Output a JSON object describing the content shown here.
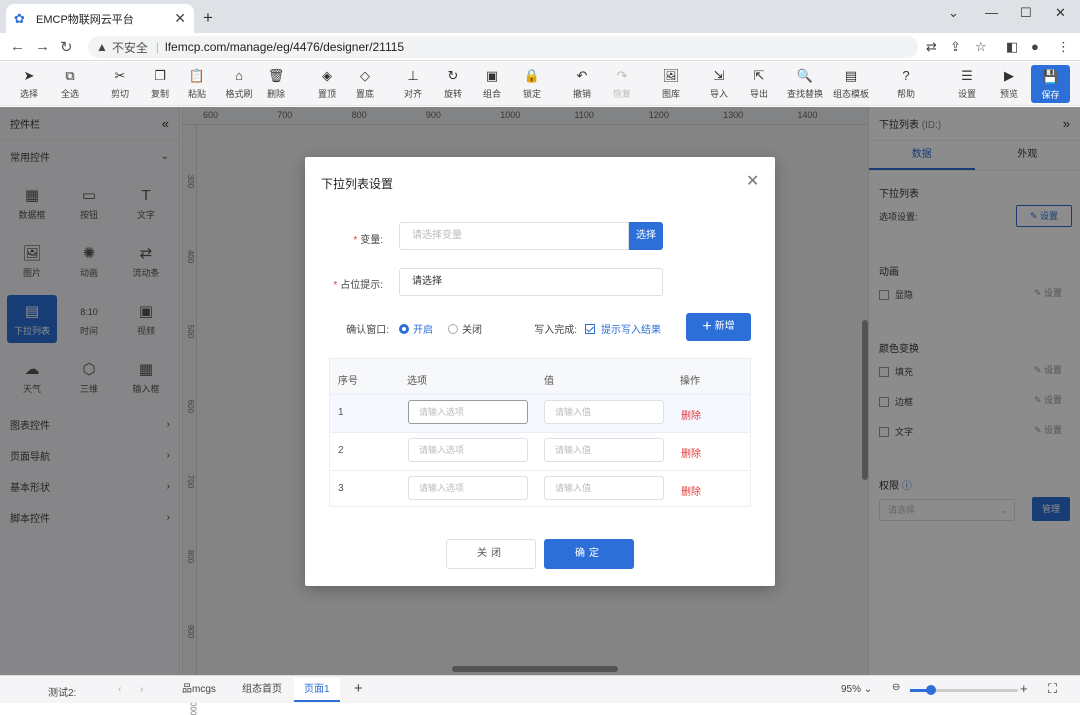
{
  "browser": {
    "tab_title": "EMCP物联网云平台",
    "insecure": "不安全",
    "url": "lfemcp.com/manage/eg/4476/designer/21115"
  },
  "toolbar": [
    {
      "id": "select",
      "label": "选择",
      "glyph": "➤"
    },
    {
      "id": "select-all",
      "label": "全选",
      "glyph": "⧉"
    },
    {
      "id": "cut",
      "label": "剪切",
      "glyph": "✂"
    },
    {
      "id": "copy",
      "label": "复制",
      "glyph": "❐"
    },
    {
      "id": "paste",
      "label": "粘贴",
      "glyph": "📋"
    },
    {
      "id": "format-brush",
      "label": "格式刷",
      "glyph": "⌂"
    },
    {
      "id": "delete",
      "label": "删除",
      "glyph": "🗑"
    },
    {
      "id": "bring-top",
      "label": "置顶",
      "glyph": "◈"
    },
    {
      "id": "send-bottom",
      "label": "置底",
      "glyph": "◇"
    },
    {
      "id": "align",
      "label": "对齐",
      "glyph": "⊥"
    },
    {
      "id": "rotate",
      "label": "旋转",
      "glyph": "↻"
    },
    {
      "id": "group",
      "label": "组合",
      "glyph": "▣"
    },
    {
      "id": "lock",
      "label": "锁定",
      "glyph": "🔒"
    },
    {
      "id": "undo",
      "label": "撤销",
      "glyph": "↶"
    },
    {
      "id": "redo",
      "label": "恢复",
      "glyph": "↷"
    },
    {
      "id": "gallery",
      "label": "图库",
      "glyph": "🖼"
    },
    {
      "id": "import",
      "label": "导入",
      "glyph": "⇲"
    },
    {
      "id": "export",
      "label": "导出",
      "glyph": "⇱"
    },
    {
      "id": "find-replace",
      "label": "查找替换",
      "glyph": "🔍"
    },
    {
      "id": "template",
      "label": "组态模板",
      "glyph": "▤"
    },
    {
      "id": "help",
      "label": "帮助",
      "glyph": "?"
    },
    {
      "id": "settings",
      "label": "设置",
      "glyph": "☰"
    },
    {
      "id": "preview",
      "label": "预览",
      "glyph": "▶"
    }
  ],
  "save_label": "保存",
  "left_panel": {
    "title": "控件栏",
    "section_common": "常用控件",
    "widgets": [
      {
        "id": "data-box",
        "label": "数据框",
        "glyph": "▦"
      },
      {
        "id": "button",
        "label": "按钮",
        "glyph": "▭"
      },
      {
        "id": "text",
        "label": "文字",
        "glyph": "T"
      },
      {
        "id": "image",
        "label": "图片",
        "glyph": "🖼"
      },
      {
        "id": "animation",
        "label": "动画",
        "glyph": "✺"
      },
      {
        "id": "flow-bar",
        "label": "流动条",
        "glyph": "⇄"
      },
      {
        "id": "dropdown-list",
        "label": "下拉列表",
        "glyph": "▤"
      },
      {
        "id": "time",
        "label": "时间",
        "glyph": "8:10"
      },
      {
        "id": "video",
        "label": "视频",
        "glyph": "▣"
      },
      {
        "id": "weather",
        "label": "天气",
        "glyph": "☁"
      },
      {
        "id": "3d",
        "label": "三维",
        "glyph": "⬡"
      },
      {
        "id": "input-box",
        "label": "输入框",
        "glyph": "▦"
      }
    ],
    "categories": [
      "图表控件",
      "页面导航",
      "基本形状",
      "脚本控件"
    ]
  },
  "rulers": {
    "h": [
      "600",
      "700",
      "800",
      "900",
      "1000",
      "1100",
      "1200",
      "1300",
      "1400"
    ],
    "v": [
      "300",
      "400",
      "500",
      "600",
      "700",
      "800",
      "900",
      "1000"
    ]
  },
  "right_panel": {
    "title": "下拉列表",
    "id_label": "(ID:)",
    "tab_data": "数据",
    "tab_look": "外观",
    "sec_dropdown": "下拉列表",
    "options_label": "选项设置:",
    "set_button": "设置",
    "sec_anim": "动画",
    "hide": "显隐",
    "sec_color": "颜色变换",
    "fill": "填充",
    "border": "边框",
    "text": "文字",
    "sec_perm": "权限",
    "perm_placeholder": "请选择",
    "manage_button": "管理"
  },
  "status": {
    "test": "测试2:",
    "page_mcgs": "品mcgs",
    "page_home": "组态首页",
    "page_1": "页面1",
    "zoom": "95%"
  },
  "dialog": {
    "title": "下拉列表设置",
    "variable_label": "变量:",
    "variable_placeholder": "请选择变量",
    "select_button": "选择",
    "placeholder_label": "占位提示:",
    "placeholder_value": "请选择",
    "confirm_label": "确认窗口:",
    "confirm_on": "开启",
    "confirm_off": "关闭",
    "write_done_label": "写入完成:",
    "write_done_option": "提示写入结果",
    "add_button": "新增",
    "table": {
      "headers": [
        "序号",
        "选项",
        "值",
        "操作"
      ],
      "rows": [
        {
          "index": "1",
          "option_placeholder": "请输入选项",
          "value_placeholder": "请输入值",
          "action": "删除"
        },
        {
          "index": "2",
          "option_placeholder": "请输入选项",
          "value_placeholder": "请输入值",
          "action": "删除"
        },
        {
          "index": "3",
          "option_placeholder": "请输入选项",
          "value_placeholder": "请输入值",
          "action": "删除"
        }
      ]
    },
    "close_button": "关闭",
    "ok_button": "确定"
  }
}
